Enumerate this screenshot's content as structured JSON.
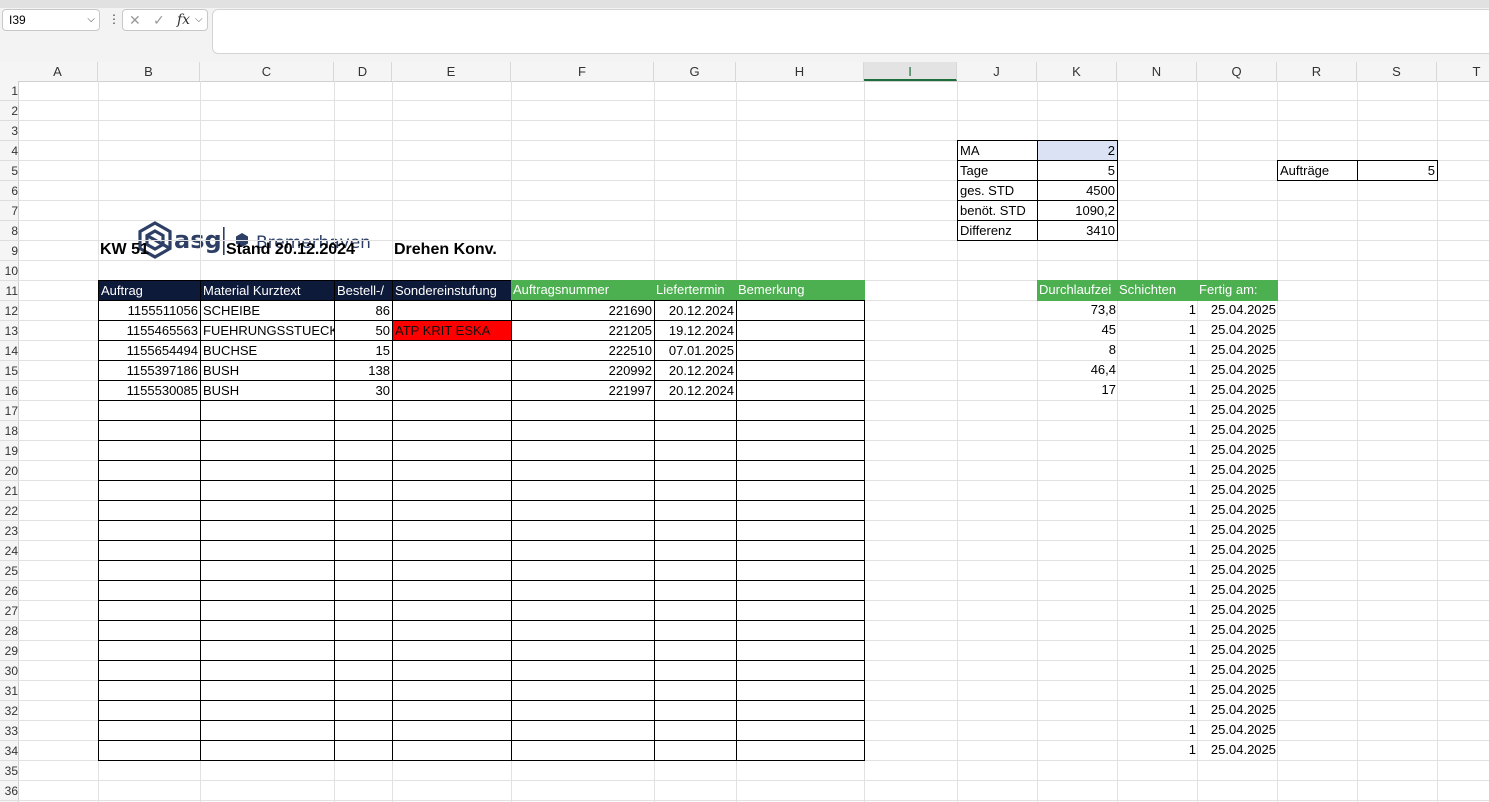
{
  "toolbar": {
    "name_box": "I39",
    "more": "⋮",
    "cancel_glyph": "✕",
    "enter_glyph": "✓",
    "fx_label": "fx",
    "formula_value": ""
  },
  "columns": [
    "A",
    "B",
    "C",
    "D",
    "E",
    "F",
    "G",
    "H",
    "I",
    "J",
    "K",
    "N",
    "Q",
    "R",
    "S",
    "T"
  ],
  "selected_column": "I",
  "rows": [
    "1",
    "2",
    "3",
    "4",
    "5",
    "6",
    "7",
    "8",
    "9",
    "10",
    "11",
    "12",
    "13",
    "14",
    "15",
    "16",
    "17",
    "18",
    "19",
    "20",
    "21",
    "22",
    "23",
    "24",
    "25",
    "26",
    "27",
    "28",
    "29",
    "30",
    "31",
    "32",
    "33",
    "34",
    "35",
    "36"
  ],
  "logo": {
    "brand": "asg",
    "location": "Bremerhaven"
  },
  "heading": {
    "week": "KW 51",
    "stand": "Stand 20.12.2024",
    "area": "Drehen Konv."
  },
  "summary": {
    "rows": [
      {
        "label": "MA",
        "value": "2"
      },
      {
        "label": "Tage",
        "value": "5"
      },
      {
        "label": "ges. STD",
        "value": "4500"
      },
      {
        "label": "benöt. STD",
        "value": "1090,2"
      },
      {
        "label": "Differenz",
        "value": "3410"
      }
    ],
    "auftraege_label": "Aufträge",
    "auftraege_value": "5"
  },
  "orders": {
    "headers": [
      "Auftrag",
      "Material Kurztext",
      "Bestell-/",
      "Sondereinstufung",
      "Auftragsnummer",
      "Liefertermin",
      "Bemerkung"
    ],
    "rows": [
      {
        "auftrag": "1155511056",
        "material": "SCHEIBE",
        "bestell": "86",
        "sonder": "",
        "nummer": "221690",
        "termin": "20.12.2024",
        "bemerkung": ""
      },
      {
        "auftrag": "1155465563",
        "material": "FUEHRUNGSSTUECK",
        "bestell": "50",
        "sonder": "ATP KRIT ESKA",
        "nummer": "221205",
        "termin": "19.12.2024",
        "bemerkung": ""
      },
      {
        "auftrag": "1155654494",
        "material": "BUCHSE",
        "bestell": "15",
        "sonder": "",
        "nummer": "222510",
        "termin": "07.01.2025",
        "bemerkung": ""
      },
      {
        "auftrag": "1155397186",
        "material": "BUSH",
        "bestell": "138",
        "sonder": "",
        "nummer": "220992",
        "termin": "20.12.2024",
        "bemerkung": ""
      },
      {
        "auftrag": "1155530085",
        "material": "BUSH",
        "bestell": "30",
        "sonder": "",
        "nummer": "221997",
        "termin": "20.12.2024",
        "bemerkung": ""
      }
    ],
    "empty_rows": 18
  },
  "planning": {
    "headers": [
      "Durchlaufzei",
      "Schichten",
      "Fertig am:"
    ],
    "durchlauf": [
      "73,8",
      "45",
      "8",
      "46,4",
      "17"
    ],
    "schichten": "1",
    "fertig": "25.04.2025",
    "row_count": 23
  }
}
